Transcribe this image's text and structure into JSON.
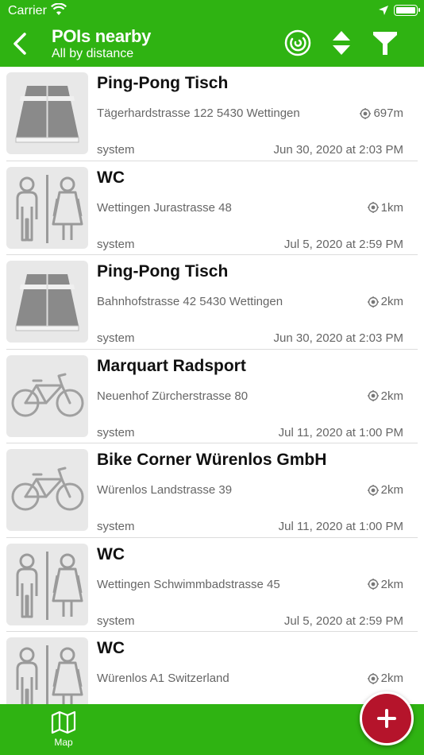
{
  "status_bar": {
    "carrier": "Carrier",
    "time": ""
  },
  "header": {
    "title": "POIs nearby",
    "subtitle": "All by distance"
  },
  "pois": [
    {
      "icon": "ping-pong-table",
      "name": "Ping-Pong Tisch",
      "address": "Tägerhardstrasse 122 5430 Wettingen",
      "distance": "697m",
      "author": "system",
      "date": "Jun 30, 2020 at 2:03 PM"
    },
    {
      "icon": "wc",
      "name": "WC",
      "address": "Wettingen Jurastrasse 48",
      "distance": "1km",
      "author": "system",
      "date": "Jul 5, 2020 at 2:59 PM"
    },
    {
      "icon": "ping-pong-table",
      "name": "Ping-Pong Tisch",
      "address": "Bahnhofstrasse 42 5430 Wettingen",
      "distance": "2km",
      "author": "system",
      "date": "Jun 30, 2020 at 2:03 PM"
    },
    {
      "icon": "bicycle",
      "name": "Marquart Radsport",
      "address": "Neuenhof Zürcherstrasse 80",
      "distance": "2km",
      "author": "system",
      "date": "Jul 11, 2020 at 1:00 PM"
    },
    {
      "icon": "bicycle",
      "name": "Bike Corner Würenlos GmbH",
      "address": "Würenlos Landstrasse 39",
      "distance": "2km",
      "author": "system",
      "date": "Jul 11, 2020 at 1:00 PM"
    },
    {
      "icon": "wc",
      "name": "WC",
      "address": "Wettingen Schwimmbadstrasse 45",
      "distance": "2km",
      "author": "system",
      "date": "Jul 5, 2020 at 2:59 PM"
    },
    {
      "icon": "wc",
      "name": "WC",
      "address": "Würenlos A1 Switzerland",
      "distance": "2km",
      "author": "",
      "date": ""
    }
  ],
  "tab_bar": {
    "map_label": "Map"
  },
  "colors": {
    "brand_green": "#2fb312",
    "fab_red": "#b5142b"
  }
}
